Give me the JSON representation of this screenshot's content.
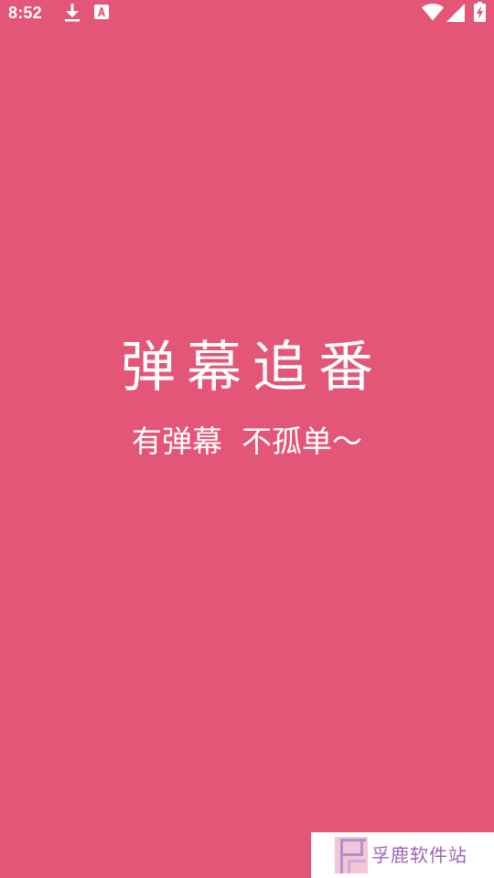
{
  "status_bar": {
    "time": "8:52",
    "left_icons": [
      "download-icon",
      "app-notification-icon"
    ],
    "right_icons": [
      "wifi-icon",
      "cellular-signal-icon",
      "battery-charging-icon"
    ]
  },
  "splash": {
    "title": "弹幕追番",
    "tagline": "有弹幕  不孤单～",
    "background_color": "#E35677",
    "text_color": "#FFFFFF"
  },
  "watermark": {
    "logo_icon": "fulu-logo-icon",
    "text": "孚鹿软件站",
    "text_color": "#9D64B8"
  }
}
